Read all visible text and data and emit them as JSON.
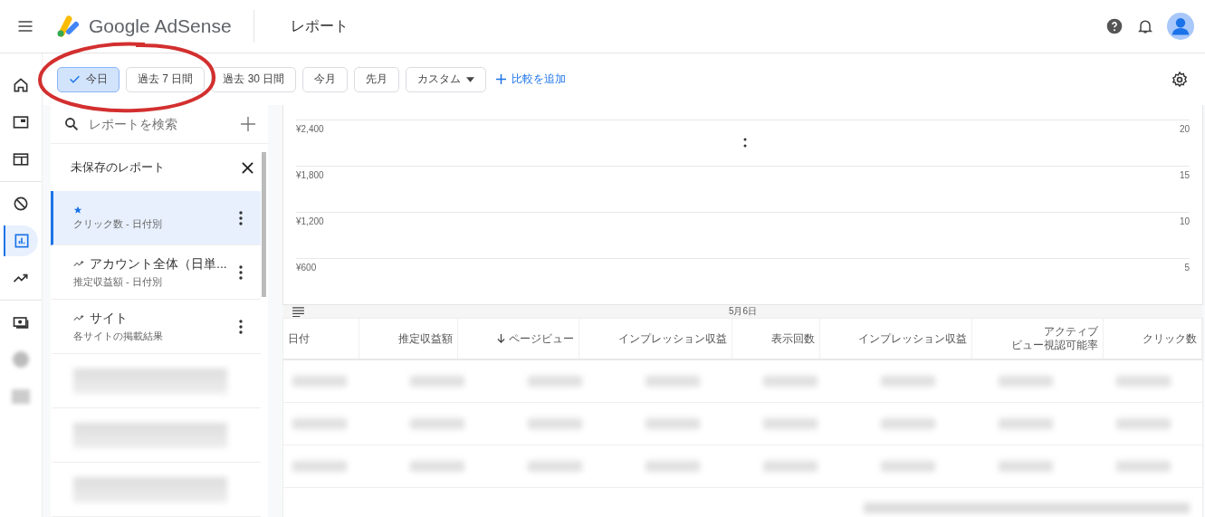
{
  "header": {
    "brand": "Google AdSense",
    "page_title": "レポート"
  },
  "nav_rail": [
    {
      "selected": false
    },
    {
      "selected": false
    },
    {
      "selected": false
    },
    {
      "selected": false
    },
    {
      "selected": true
    },
    {
      "selected": false
    },
    {
      "selected": false
    },
    {
      "selected": false
    },
    {
      "selected": false
    }
  ],
  "date_filters": [
    {
      "label": "今日",
      "selected": true,
      "kind": "chip"
    },
    {
      "label": "過去 7 日間",
      "selected": false,
      "kind": "chip"
    },
    {
      "label": "過去 30 日間",
      "selected": false,
      "kind": "chip"
    },
    {
      "label": "今月",
      "selected": false,
      "kind": "chip"
    },
    {
      "label": "先月",
      "selected": false,
      "kind": "chip"
    },
    {
      "label": "カスタム",
      "selected": false,
      "kind": "dropdown"
    }
  ],
  "add_comparison": "比較を追加",
  "sidebar": {
    "search": {
      "placeholder": "レポートを検索"
    },
    "unsaved": "未保存のレポート",
    "items": [
      {
        "kind": "starred",
        "subtitle": "クリック数 - 日付別",
        "selected": true
      },
      {
        "kind": "preset",
        "title": "アカウント全体（日単...",
        "subtitle": "推定収益額 - 日付別",
        "selected": false
      },
      {
        "kind": "preset",
        "title": "サイト",
        "subtitle": "各サイトの掲載結果",
        "selected": false
      }
    ]
  },
  "chart": {
    "left_axis": [
      "¥2,400",
      "¥1,800",
      "¥1,200",
      "¥600"
    ],
    "right_axis": [
      "20",
      "15",
      "10",
      "5"
    ],
    "x_label": "5月6日"
  },
  "table": {
    "columns": [
      {
        "label": "日付",
        "sorted": false
      },
      {
        "label": "推定収益額",
        "sorted": false
      },
      {
        "label": "ページビュー",
        "sorted": true
      },
      {
        "label": "インプレッション収益",
        "sorted": false
      },
      {
        "label": "表示回数",
        "sorted": false
      },
      {
        "label": "インプレッション収益",
        "sorted": false
      },
      {
        "label": "アクティブ",
        "label_line2": "ビュー視認可能率",
        "sorted": false
      },
      {
        "label": "クリック数",
        "sorted": false
      }
    ]
  }
}
